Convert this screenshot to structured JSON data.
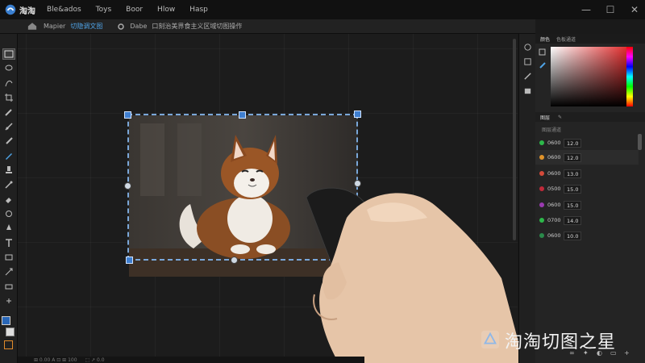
{
  "app": {
    "name": "淘淘",
    "logo_icon": "app-logo-icon"
  },
  "menu": {
    "items": [
      "Ble&ados",
      "Toys",
      "Boor",
      "Hlow",
      "Hasp"
    ]
  },
  "window_controls": {
    "minimize": "—",
    "maximize": "☐",
    "close": "✕"
  },
  "options_bar": {
    "mode_label": "Mapier",
    "accent_text": "切隐调文图",
    "mode2_label": "Dabe",
    "description": "口刻治美界食主义区域切图操作"
  },
  "panel": {
    "tabs": [
      "颜色",
      "色板通道"
    ],
    "sub_tabs": [
      "图层",
      "✎"
    ],
    "sub_label": "图层通道",
    "layers": [
      {
        "name": "0600",
        "value": "12.0",
        "color": "#2db84a"
      },
      {
        "name": "0600",
        "value": "12.0",
        "color": "#e0932a"
      },
      {
        "name": "0600",
        "value": "13.0",
        "color": "#d44a3a"
      },
      {
        "name": "0500",
        "value": "15.0",
        "color": "#c02a3a"
      },
      {
        "name": "0600",
        "value": "15.0",
        "color": "#9a3ab0"
      },
      {
        "name": "0700",
        "value": "14.0",
        "color": "#2db84a"
      },
      {
        "name": "0600",
        "value": "10.0",
        "color": "#2a8a4a"
      }
    ]
  },
  "status": {
    "left": "⊞ 0.00 A  ⊡ ⊞ 100",
    "mid": "⬚ ↗ 0.0"
  },
  "watermark": {
    "text": "淘淘切图之星",
    "icon": "star-logo-icon"
  },
  "colors": {
    "accent": "#4fa3e6",
    "selection": "#7aa7d9",
    "handle": "#3f7fd0",
    "foreground": "#2866b8"
  }
}
